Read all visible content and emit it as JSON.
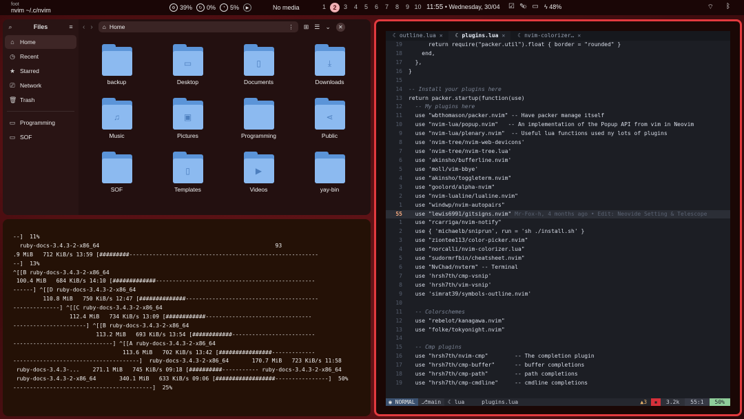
{
  "topbar": {
    "app": "foot",
    "title": "nvim ~/.c/nvim",
    "cpu": "39%",
    "mem": "0%",
    "vol": "5%",
    "media": "No media",
    "workspaces": [
      "1",
      "2",
      "3",
      "4",
      "5",
      "6",
      "7",
      "8",
      "9",
      "10"
    ],
    "active_workspace": "2",
    "time": "11:55",
    "date": "• Wednesday, 30/04",
    "battery": "48%",
    "icons": [
      "tasks-icon",
      "sun-icon",
      "pen-icon",
      "screen-icon",
      "bolt-icon",
      "wifi-icon",
      "bluetooth-icon"
    ]
  },
  "files": {
    "header_title": "Files",
    "path": "Home",
    "sidebar": [
      {
        "label": "Home",
        "icon": "home-icon",
        "selected": true
      },
      {
        "label": "Recent",
        "icon": "clock-icon"
      },
      {
        "label": "Starred",
        "icon": "star-icon"
      },
      {
        "label": "Network",
        "icon": "network-icon"
      },
      {
        "label": "Trash",
        "icon": "trash-icon"
      }
    ],
    "bookmarks": [
      {
        "label": "Programming",
        "icon": "folder-icon"
      },
      {
        "label": "SOF",
        "icon": "folder-icon"
      }
    ],
    "items": [
      {
        "label": "backup",
        "glyph": ""
      },
      {
        "label": "Desktop",
        "glyph": "▭"
      },
      {
        "label": "Documents",
        "glyph": "▯"
      },
      {
        "label": "Downloads",
        "glyph": "⤓"
      },
      {
        "label": "Music",
        "glyph": "♫"
      },
      {
        "label": "Pictures",
        "glyph": "▣"
      },
      {
        "label": "Programming",
        "glyph": ""
      },
      {
        "label": "Public",
        "glyph": "⋖"
      },
      {
        "label": "SOF",
        "glyph": ""
      },
      {
        "label": "Templates",
        "glyph": "▯"
      },
      {
        "label": "Videos",
        "glyph": "▶"
      },
      {
        "label": "yay-bin",
        "glyph": ""
      }
    ]
  },
  "terminal": {
    "lines": [
      "--]  11%",
      "  ruby-docs-3.4.3-2-x86_64                                                     93",
      ".9 MiB   712 KiB/s 13:59 [#########---------------------------------------------------------",
      "--]  13%",
      "^[[B ruby-docs-3.4.3-2-x86_64",
      " 100.4 MiB   684 KiB/s 14:10 [#############------------------------------------------------",
      "------] ^[[D ruby-docs-3.4.3-2-x86_64",
      "         110.8 MiB   750 KiB/s 12:47 [##############----------------------------------------",
      "--------------] ^[[C ruby-docs-3.4.3-2-x86_64",
      "                 112.4 MiB   734 KiB/s 13:09 [############--------------------------------",
      "----------------------] ^[[B ruby-docs-3.4.3-2-x86_64",
      "                         113.2 MiB   693 KiB/s 13:54 [############-------------------------",
      "------------------------------] ^[[A ruby-docs-3.4.3-2-x86_64",
      "                                 113.6 MiB   702 KiB/s 13:42 [################-------------",
      "--------------------------------------]  ruby-docs-3.4.3-2-x86_64       170.7 MiB   723 KiB/s 11:58",
      " ruby-docs-3.4.3-...    271.1 MiB   745 KiB/s 09:18 [##########----------- ruby-docs-3.4.3-2-x86_64",
      " ruby-docs-3.4.3-2-x86_64       340.1 MiB   633 KiB/s 09:06 [##################----------------]  50%",
      "------------------------------------------]  25%"
    ]
  },
  "nvim": {
    "tabs": [
      {
        "label": "outline.lua",
        "icon": "lua-icon",
        "active": false
      },
      {
        "label": "plugins.lua",
        "icon": "lua-icon",
        "active": true
      },
      {
        "label": "nvim-colorizer…",
        "icon": "lua-icon",
        "active": false
      }
    ],
    "lines": [
      {
        "n": "19",
        "t": "      return require(\"packer.util\").float { border = \"rounded\" }",
        "k": "code"
      },
      {
        "n": "18",
        "t": "    end,",
        "k": "code"
      },
      {
        "n": "17",
        "t": "  },",
        "k": "code"
      },
      {
        "n": "16",
        "t": "}",
        "k": "code"
      },
      {
        "n": "15",
        "t": "",
        "k": "code"
      },
      {
        "n": "14",
        "t": "-- Install your plugins here",
        "k": "cmt"
      },
      {
        "n": "13",
        "t": "return packer.startup(function(use)",
        "k": "code"
      },
      {
        "n": "12",
        "t": "  -- My plugins here",
        "k": "cmt"
      },
      {
        "n": "11",
        "t": "  use \"wbthomason/packer.nvim\" -- Have packer manage itself",
        "k": "code"
      },
      {
        "n": "10",
        "t": "  use \"nvim-lua/popup.nvim\"   -- An implementation of the Popup API from vim in Neovim",
        "k": "code"
      },
      {
        "n": "9",
        "t": "  use \"nvim-lua/plenary.nvim\"  -- Useful lua functions used ny lots of plugins",
        "k": "code"
      },
      {
        "n": "8",
        "t": "  use 'nvim-tree/nvim-web-devicons'",
        "k": "code"
      },
      {
        "n": "7",
        "t": "  use 'nvim-tree/nvim-tree.lua'",
        "k": "code"
      },
      {
        "n": "6",
        "t": "  use 'akinsho/bufferline.nvim'",
        "k": "code"
      },
      {
        "n": "5",
        "t": "  use 'moll/vim-bbye'",
        "k": "code"
      },
      {
        "n": "4",
        "t": "  use \"akinsho/toggleterm.nvim\"",
        "k": "code"
      },
      {
        "n": "3",
        "t": "  use \"goolord/alpha-nvim\"",
        "k": "code"
      },
      {
        "n": "2",
        "t": "  use \"nvim-lualine/lualine.nvim\"",
        "k": "code"
      },
      {
        "n": "1",
        "t": "  use \"windwp/nvim-autopairs\"",
        "k": "code"
      },
      {
        "n": "55",
        "t": "  use \"lewis6991/gitsigns.nvim\" ",
        "blame": "Mr-Fox-h, 4 months ago • Edit: Neovide Setting & Telescope",
        "k": "cur"
      },
      {
        "n": "1",
        "t": "  use \"rcarriga/nvim-notify\"",
        "k": "code"
      },
      {
        "n": "2",
        "t": "  use { 'michaelb/sniprun', run = 'sh ./install.sh' }",
        "k": "code"
      },
      {
        "n": "3",
        "t": "  use \"ziontee113/color-picker.nvim\"",
        "k": "code"
      },
      {
        "n": "4",
        "t": "  use \"norcalli/nvim-colorizer.lua\"",
        "k": "code"
      },
      {
        "n": "5",
        "t": "  use \"sudormrfbin/cheatsheet.nvim\"",
        "k": "code"
      },
      {
        "n": "6",
        "t": "  use \"NvChad/nvterm\" -- Terminal",
        "k": "code"
      },
      {
        "n": "7",
        "t": "  use 'hrsh7th/cmp-vsnip'",
        "k": "code"
      },
      {
        "n": "8",
        "t": "  use 'hrsh7th/vim-vsnip'",
        "k": "code"
      },
      {
        "n": "9",
        "t": "  use 'simrat39/symbols-outline.nvim'",
        "k": "code"
      },
      {
        "n": "10",
        "t": "",
        "k": "code"
      },
      {
        "n": "11",
        "t": "  -- Colorschemes",
        "k": "cmt"
      },
      {
        "n": "12",
        "t": "  use \"rebelot/kanagawa.nvim\"",
        "k": "code"
      },
      {
        "n": "13",
        "t": "  use \"folke/tokyonight.nvim\"",
        "k": "code"
      },
      {
        "n": "14",
        "t": "",
        "k": "code"
      },
      {
        "n": "15",
        "t": "  -- Cmp plugins",
        "k": "cmt"
      },
      {
        "n": "16",
        "t": "  use \"hrsh7th/nvim-cmp\"        -- The completion plugin",
        "k": "code"
      },
      {
        "n": "17",
        "t": "  use \"hrsh7th/cmp-buffer\"      -- buffer completions",
        "k": "code"
      },
      {
        "n": "18",
        "t": "  use \"hrsh7th/cmp-path\"        -- path completions",
        "k": "code"
      },
      {
        "n": "19",
        "t": "  use \"hrsh7th/cmp-cmdline\"     -- cmdline completions",
        "k": "code"
      }
    ],
    "status": {
      "mode": "NORMAL",
      "branch": "main",
      "lang": "lua",
      "file": "plugins.lua",
      "warnings": "3",
      "size": "3.2k",
      "position": "55:1",
      "percent": "50%"
    }
  }
}
